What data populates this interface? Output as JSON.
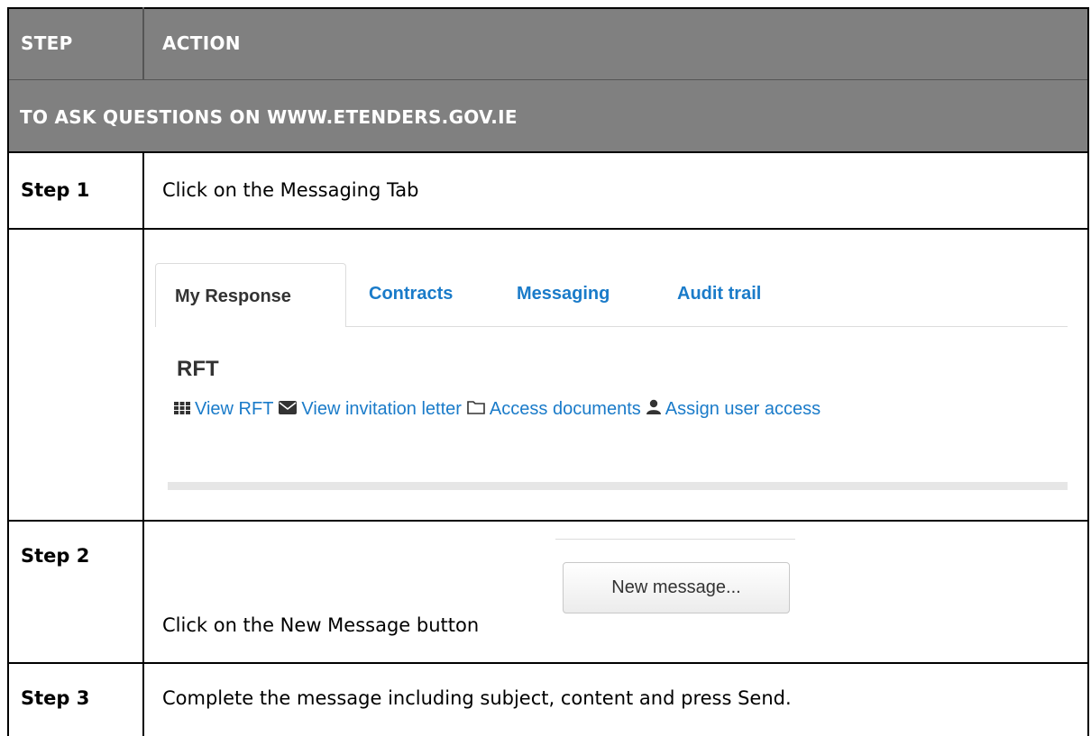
{
  "header": {
    "col_step": "STEP",
    "col_action": "ACTION",
    "section_title": "TO ASK QUESTIONS ON WWW.ETENDERS.GOV.IE"
  },
  "rows": [
    {
      "step": "Step 1",
      "action": "Click on the Messaging Tab"
    },
    {
      "step": "Step 2",
      "action": "Click on the New Message button"
    },
    {
      "step": "Step 3",
      "action": "Complete the message including subject, content and press Send."
    }
  ],
  "screenshot": {
    "tabs": [
      "My Response",
      "Contracts",
      "Messaging",
      "Audit trail"
    ],
    "active_tab": "My Response",
    "heading": "RFT",
    "links": [
      {
        "label": "View RFT",
        "icon": "grid-icon"
      },
      {
        "label": "View invitation letter",
        "icon": "envelope-icon"
      },
      {
        "label": "Access documents",
        "icon": "folder-icon"
      },
      {
        "label": "Assign user access",
        "icon": "user-icon"
      }
    ],
    "new_message_button": "New message..."
  },
  "colors": {
    "header_bg": "#808080",
    "link": "#1a7bc9"
  }
}
